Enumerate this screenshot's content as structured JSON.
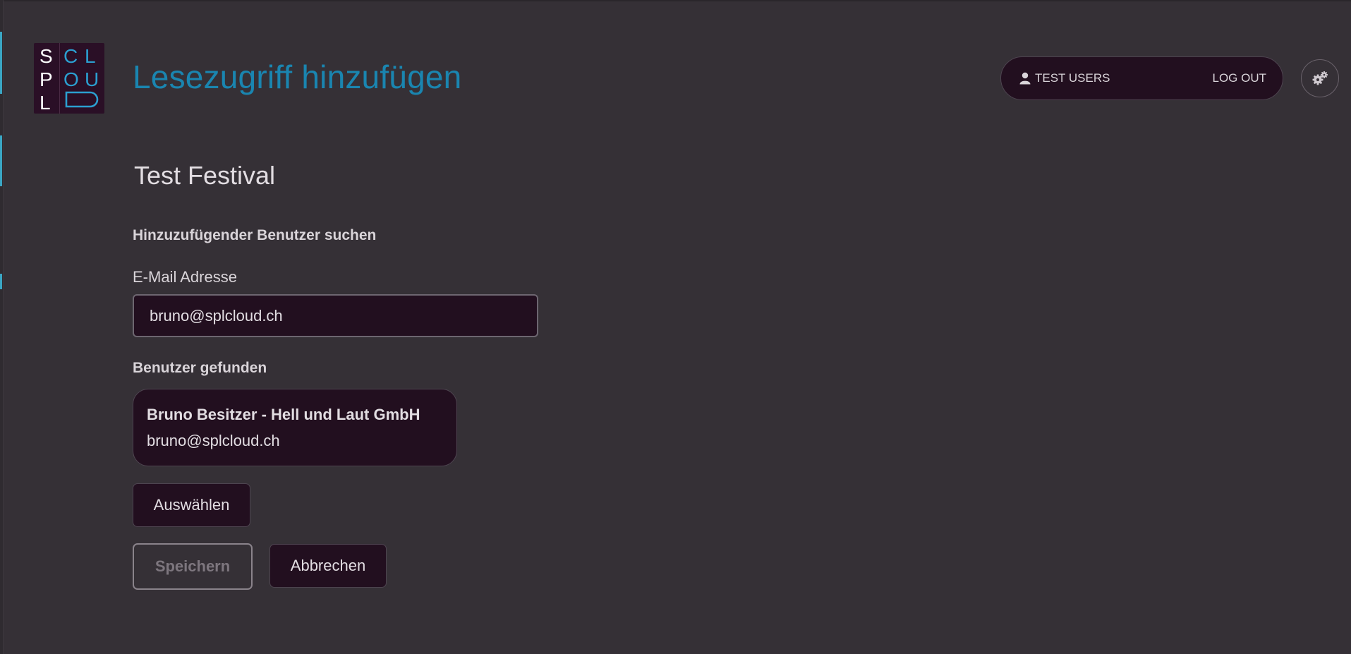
{
  "logo": {
    "letters_left": [
      "S",
      "P",
      "L"
    ],
    "letters_right": [
      "C",
      "L",
      "O",
      "U"
    ]
  },
  "header": {
    "title": "Lesezugriff hinzufügen",
    "user_label": "TEST USERS",
    "logout_label": "LOG OUT"
  },
  "main": {
    "event_name": "Test Festival",
    "search_heading": "Hinzuzufügender Benutzer suchen",
    "email_label": "E-Mail Adresse",
    "email_value": "bruno@splcloud.ch",
    "found_heading": "Benutzer gefunden",
    "result": {
      "name": "Bruno Besitzer - Hell und Laut GmbH",
      "email": "bruno@splcloud.ch"
    },
    "select_label": "Auswählen",
    "save_label": "Speichern",
    "cancel_label": "Abbrechen"
  },
  "colors": {
    "background": "#353036",
    "panel": "#220f1f",
    "title_accent": "#1a85b0",
    "logo_white": "#ffffff",
    "logo_blue": "#2b9fd0"
  },
  "icons": [
    "user-icon",
    "gears-icon",
    "logo-icon"
  ]
}
